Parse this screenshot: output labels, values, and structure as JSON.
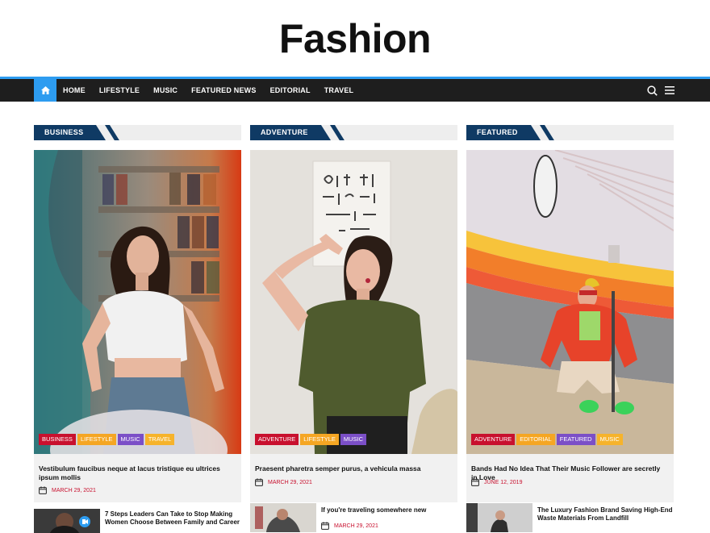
{
  "site": {
    "title": "Fashion"
  },
  "nav": {
    "home_icon": "home-icon",
    "items": [
      "HOME",
      "LIFESTYLE",
      "MUSIC",
      "FEATURED NEWS",
      "EDITORIAL",
      "TRAVEL"
    ],
    "search_icon": "search-icon",
    "menu_icon": "hamburger-menu-icon"
  },
  "colors": {
    "accent": "#2d9cf0",
    "nav_bg": "#1e1e1e",
    "section_tab": "#0f3a64",
    "date": "#c8102e"
  },
  "columns": [
    {
      "section": "BUSINESS",
      "categories": [
        "BUSINESS",
        "LIFESTYLE",
        "MUSIC",
        "TRAVEL"
      ],
      "title": "Vestibulum faucibus neque at lacus tristique eu ultrices ipsum mollis",
      "date": "MARCH 29, 2021",
      "small": {
        "title": "7 Steps Leaders Can Take to Stop Making Women Choose Between Family and Career",
        "date": ""
      }
    },
    {
      "section": "ADVENTURE",
      "categories": [
        "ADVENTURE",
        "LIFESTYLE",
        "MUSIC"
      ],
      "title": "Praesent pharetra semper purus, a vehicula massa",
      "date": "MARCH 29, 2021",
      "small": {
        "title": "If you're traveling somewhere new",
        "date": "MARCH 29, 2021"
      }
    },
    {
      "section": "FEATURED",
      "categories": [
        "ADVENTURE",
        "EDITORIAL",
        "FEATURED",
        "MUSIC"
      ],
      "title": "Bands Had No Idea That Their Music Follower are secretly in Love",
      "date": "JUNE 12, 2019",
      "small": {
        "title": "The Luxury Fashion Brand Saving High-End Waste Materials From Landfill",
        "date": ""
      }
    }
  ]
}
